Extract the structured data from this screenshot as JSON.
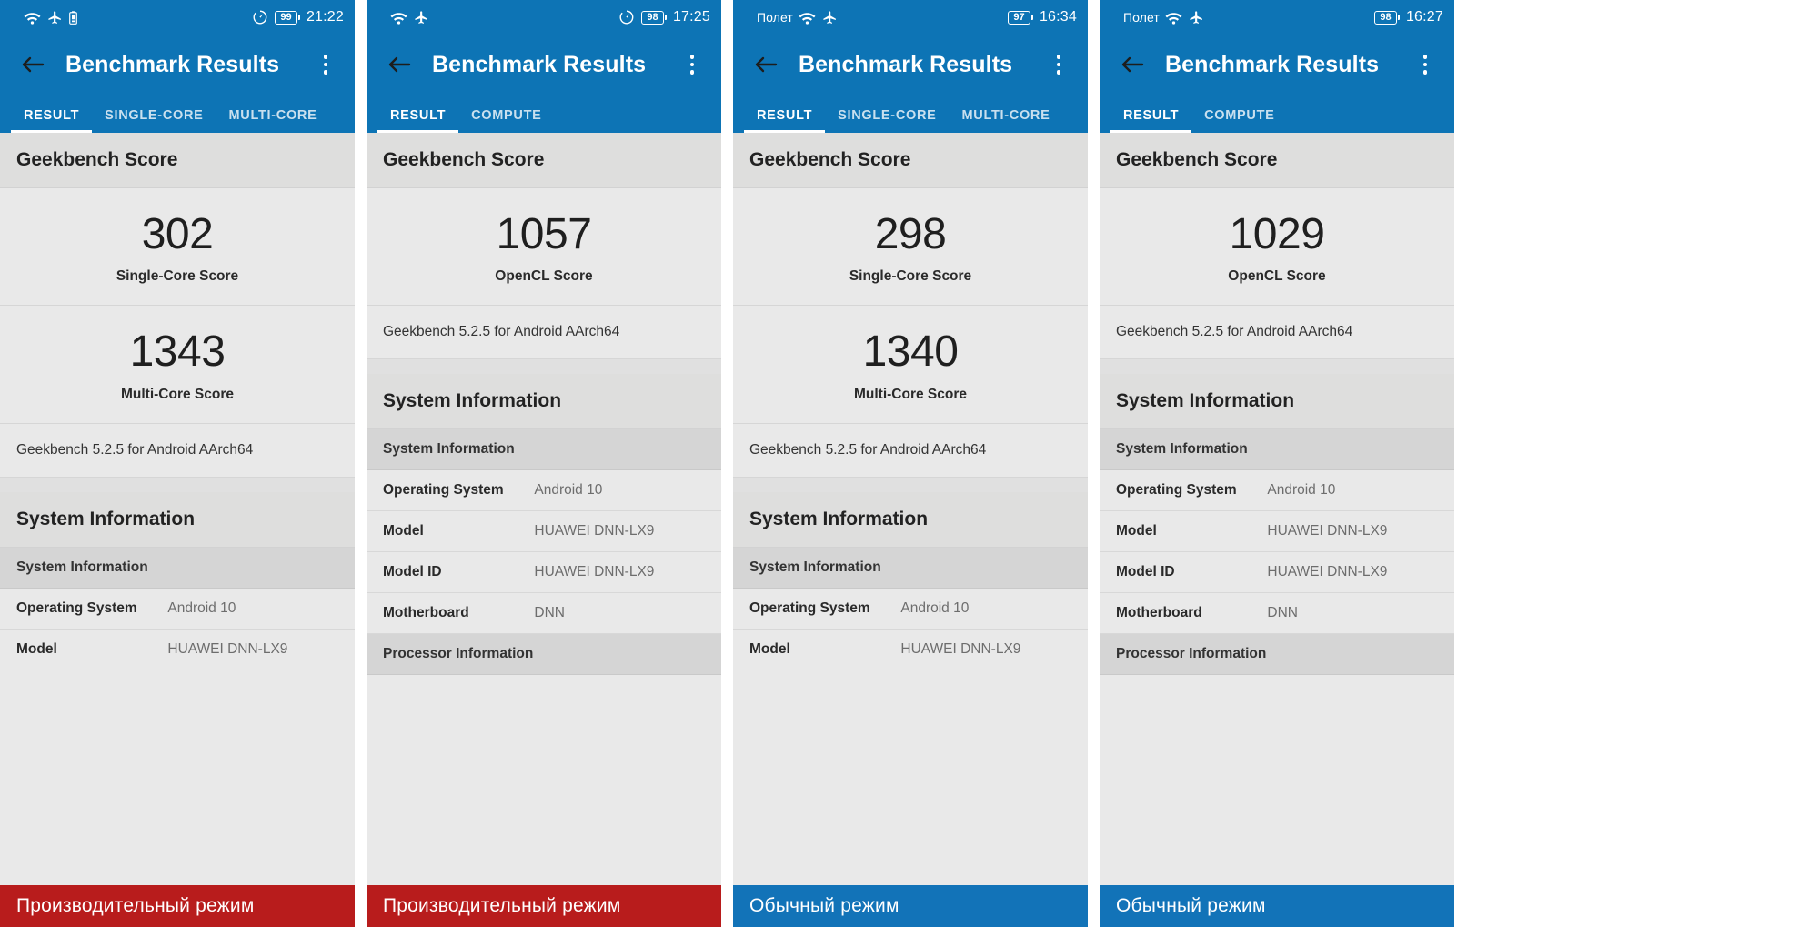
{
  "common": {
    "app_title": "Benchmark Results",
    "back_icon": "arrow-left-icon",
    "overflow_icon": "more-vertical-icon",
    "wifi_icon": "wifi-icon",
    "airplane_icon": "airplane-mode-icon",
    "speed_icon": "speedometer-icon",
    "battery_icon": "battery-icon",
    "section_geekbench": "Geekbench Score",
    "section_sysinfo": "System Information",
    "subsection_sysinfo": "System Information",
    "subsection_proc": "Processor Information",
    "version_text": "Geekbench 5.2.5 for Android AArch64",
    "key_os": "Operating System",
    "key_model": "Model",
    "key_model_id": "Model ID",
    "key_motherboard": "Motherboard",
    "val_os": "Android 10",
    "val_model": "HUAWEI DNN-LX9",
    "val_model_id": "HUAWEI DNN-LX9",
    "val_motherboard": "DNN",
    "colors": {
      "appbar_blue": "#0d74b5",
      "banner_red": "#b81c1c",
      "banner_blue": "#1273b8",
      "content_bg": "#e9e9e9"
    }
  },
  "panels": [
    {
      "id": "panel-1",
      "status": {
        "carrier": "",
        "icons": [
          "wifi-icon",
          "airplane-mode-icon",
          "battery-low-icon"
        ],
        "right_icon": "speedometer-icon",
        "battery": "99",
        "time": "21:22"
      },
      "tabs": [
        {
          "label": "RESULT",
          "active": true
        },
        {
          "label": "SINGLE-CORE",
          "active": false
        },
        {
          "label": "MULTI-CORE",
          "active": false
        }
      ],
      "scores": [
        {
          "value": "302",
          "label": "Single-Core Score"
        },
        {
          "value": "1343",
          "label": "Multi-Core Score"
        }
      ],
      "rows": [
        {
          "key": "Operating System",
          "value": "Android 10"
        },
        {
          "key": "Model",
          "value": "HUAWEI DNN-LX9"
        }
      ],
      "layout": "result",
      "banner": {
        "text": "Производительный режим",
        "color": "#b81c1c"
      }
    },
    {
      "id": "panel-2",
      "status": {
        "carrier": "",
        "icons": [
          "wifi-icon",
          "airplane-mode-icon"
        ],
        "right_icon": "speedometer-icon",
        "battery": "98",
        "time": "17:25"
      },
      "tabs": [
        {
          "label": "RESULT",
          "active": true
        },
        {
          "label": "COMPUTE",
          "active": false
        }
      ],
      "scores": [
        {
          "value": "1057",
          "label": "OpenCL Score"
        }
      ],
      "rows": [
        {
          "key": "Operating System",
          "value": "Android 10"
        },
        {
          "key": "Model",
          "value": "HUAWEI DNN-LX9"
        },
        {
          "key": "Model ID",
          "value": "HUAWEI DNN-LX9"
        },
        {
          "key": "Motherboard",
          "value": "DNN"
        }
      ],
      "layout": "compute",
      "banner": {
        "text": "Производительный режим",
        "color": "#b81c1c"
      }
    },
    {
      "id": "panel-3",
      "status": {
        "carrier": "Полет",
        "icons": [
          "wifi-icon",
          "airplane-mode-icon"
        ],
        "right_icon": "",
        "battery": "97",
        "time": "16:34"
      },
      "tabs": [
        {
          "label": "RESULT",
          "active": true
        },
        {
          "label": "SINGLE-CORE",
          "active": false
        },
        {
          "label": "MULTI-CORE",
          "active": false
        }
      ],
      "scores": [
        {
          "value": "298",
          "label": "Single-Core Score"
        },
        {
          "value": "1340",
          "label": "Multi-Core Score"
        }
      ],
      "rows": [
        {
          "key": "Operating System",
          "value": "Android 10"
        },
        {
          "key": "Model",
          "value": "HUAWEI DNN-LX9"
        }
      ],
      "layout": "result",
      "banner": {
        "text": "Обычный режим",
        "color": "#1273b8"
      }
    },
    {
      "id": "panel-4",
      "status": {
        "carrier": "Полет",
        "icons": [
          "wifi-icon",
          "airplane-mode-icon"
        ],
        "right_icon": "",
        "battery": "98",
        "time": "16:27"
      },
      "tabs": [
        {
          "label": "RESULT",
          "active": true
        },
        {
          "label": "COMPUTE",
          "active": false
        }
      ],
      "scores": [
        {
          "value": "1029",
          "label": "OpenCL Score"
        }
      ],
      "rows": [
        {
          "key": "Operating System",
          "value": "Android 10"
        },
        {
          "key": "Model",
          "value": "HUAWEI DNN-LX9"
        },
        {
          "key": "Model ID",
          "value": "HUAWEI DNN-LX9"
        },
        {
          "key": "Motherboard",
          "value": "DNN"
        }
      ],
      "layout": "compute",
      "banner": {
        "text": "Обычный режим",
        "color": "#1273b8"
      }
    }
  ]
}
